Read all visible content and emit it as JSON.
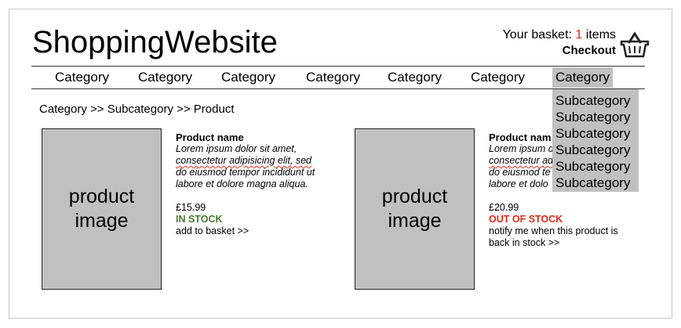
{
  "header": {
    "title": "ShoppingWebsite",
    "basket_prefix": "Your basket:",
    "basket_count": "1",
    "basket_suffix": "items",
    "checkout": "Checkout"
  },
  "nav": {
    "items": [
      "Category",
      "Category",
      "Category",
      "Category",
      "Category",
      "Category",
      "Category"
    ],
    "active_index": 6
  },
  "dropdown": {
    "items": [
      "Subcategory",
      "Subcategory",
      "Subcategory",
      "Subcategory",
      "Subcategory",
      "Subcategory"
    ]
  },
  "breadcrumb": "Category >> Subcategory >> Product",
  "products": [
    {
      "image_line1": "product",
      "image_line2": "image",
      "name": "Product name",
      "description_lines": [
        "Lorem ipsum dolor sit amet,",
        "consectetur adipisicing elit, sed",
        "do eiusmod tempor incididunt ut",
        "labore et dolore magna aliqua."
      ],
      "price": "£15.99",
      "stock": "IN STOCK",
      "action_lines": [
        "add to basket >>"
      ]
    },
    {
      "image_line1": "product",
      "image_line2": "image",
      "name": "Product nam",
      "description_lines": [
        "Lorem ipsum d",
        "consectetur ad",
        "do eiusmod te",
        "labore et dolo"
      ],
      "price": "£20.99",
      "stock": "OUT OF STOCK",
      "action_lines": [
        "notify me when this product is",
        "back in stock >>"
      ]
    }
  ],
  "colors": {
    "accent_red": "#e02a1b",
    "in_stock_green": "#4a7a2c",
    "placeholder_grey": "#c0c0c0"
  },
  "icons": {
    "basket": "shopping-basket-icon"
  }
}
